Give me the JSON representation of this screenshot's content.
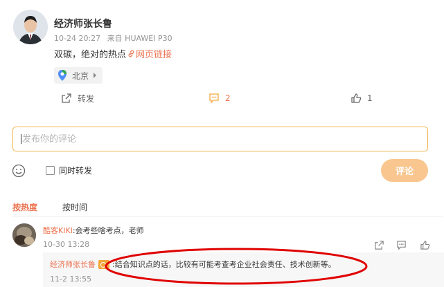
{
  "post": {
    "author": "经济师张长鲁",
    "time": "10-24 20:27",
    "source": "来自 HUAWEI P30",
    "text": "双碳，绝对的热点",
    "link_label": "网页链接",
    "location": "北京",
    "repost_label": "转发",
    "comment_count": "2",
    "like_count": "1"
  },
  "composer": {
    "placeholder": "发布你的评论",
    "repost_checkbox_label": "同时转发",
    "submit_label": "评论"
  },
  "sort": {
    "hot": "按热度",
    "time": "按时间"
  },
  "comments": [
    {
      "user": "酷客KIKI",
      "text": ":会考些啥考点，老师",
      "time": "10-30 13:28",
      "reply": {
        "user": "经济师张长鲁",
        "text": ":结合知识点的话，比较有可能考查考企业社会责任、技术创新等。",
        "time": "11-2 13:55"
      }
    }
  ],
  "colors": {
    "accent": "#eb7350",
    "input_border": "#f2b24c",
    "submit_bg": "#f9c68f",
    "comment_icon": "#f3a63a",
    "annotation": "#e00000"
  }
}
